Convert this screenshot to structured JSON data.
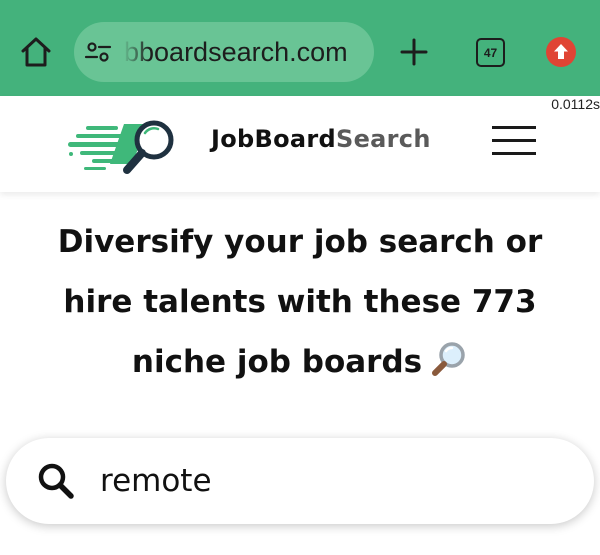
{
  "browser": {
    "url": "bboardsearch.com",
    "tab_count": "47",
    "timing": "0.0112s"
  },
  "site": {
    "brand_part1": "JobBoard",
    "brand_part2": "Search"
  },
  "hero": {
    "line1": "Diversify your job search or",
    "line2": "hire talents with these 773",
    "line3": "niche job boards"
  },
  "search": {
    "value": "remote"
  },
  "colors": {
    "browser_bar": "#44b27c",
    "url_pill": "#69c495",
    "logo_green": "#3fb87a",
    "logo_dark": "#1f3140",
    "extension_red": "#e04434"
  }
}
